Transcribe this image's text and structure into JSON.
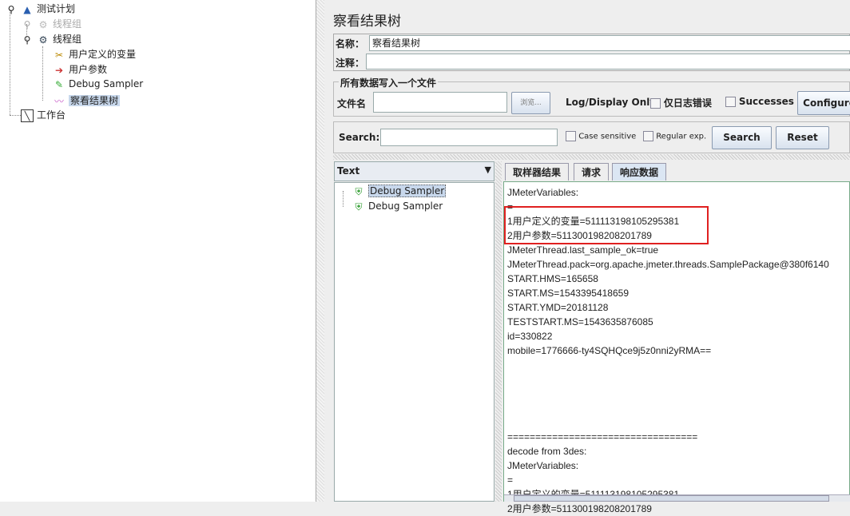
{
  "tree": {
    "items": [
      {
        "label": "测试计划",
        "icon": "test-plan-icon"
      },
      {
        "label": "线程组",
        "icon": "gear-disabled-icon"
      },
      {
        "label": "线程组",
        "icon": "gear-icon"
      },
      {
        "label": "用户定义的变量",
        "icon": "tools-icon"
      },
      {
        "label": "用户参数",
        "icon": "user-params-icon"
      },
      {
        "label": "Debug Sampler",
        "icon": "pen-icon"
      },
      {
        "label": "察看结果树",
        "icon": "graph-icon"
      },
      {
        "label": "工作台",
        "icon": "workbench-icon"
      }
    ]
  },
  "panel": {
    "title": "察看结果树",
    "name_label": "名称：",
    "name_value": "察看结果树",
    "comment_label": "注释：",
    "comment_value": "",
    "file_group": "所有数据写入一个文件",
    "file_label": "文件名",
    "file_value": "",
    "browse": "浏览...",
    "log_display": "Log/Display Only:",
    "errors_only": "仅日志错误",
    "successes": "Successes",
    "configure": "Configure"
  },
  "search": {
    "label": "Search:",
    "value": "",
    "case_sensitive": "Case sensitive",
    "regex": "Regular exp.",
    "search_btn": "Search",
    "reset_btn": "Reset"
  },
  "renderer": {
    "selected": "Text"
  },
  "results": [
    {
      "label": "Debug Sampler",
      "status": "success"
    },
    {
      "label": "Debug Sampler",
      "status": "success"
    }
  ],
  "tabs": [
    {
      "label": "取样器结果"
    },
    {
      "label": "请求"
    },
    {
      "label": "响应数据",
      "active": true
    }
  ],
  "response_lines": [
    "JMeterVariables:",
    "=",
    "1用户定义的变量=511113198105295381",
    "2用户参数=511300198208201789",
    "JMeterThread.last_sample_ok=true",
    "JMeterThread.pack=org.apache.jmeter.threads.SamplePackage@380f6140",
    "START.HMS=165658",
    "START.MS=1543395418659",
    "START.YMD=20181128",
    "TESTSTART.MS=1543635876085",
    "id=330822",
    "mobile=1776666-ty4SQHQce9j5z0nni2yRMA==",
    "",
    "",
    "",
    "",
    "",
    "==================================",
    "decode from 3des:",
    "JMeterVariables:",
    "=",
    "1用户定义的变量=511113198105295381",
    "2用户参数=511300198208201789"
  ],
  "colors": {
    "highlight_box": "#e02020",
    "selection": "#c8d8ec",
    "success": "#2a9a2a"
  }
}
